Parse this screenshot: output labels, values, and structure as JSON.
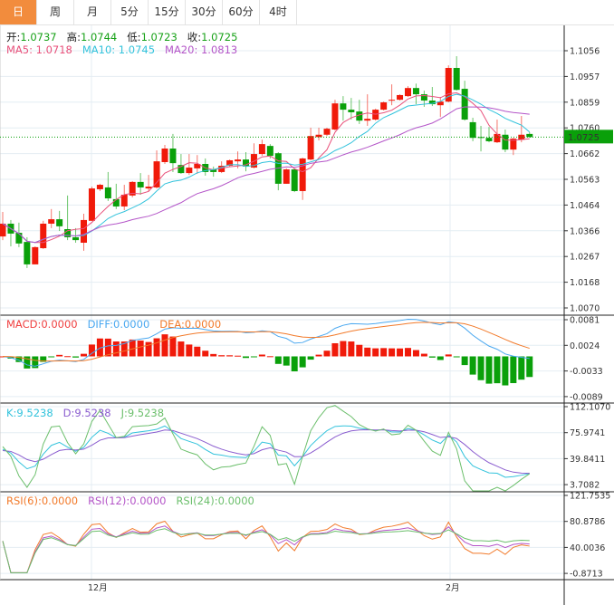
{
  "tabs": [
    {
      "label": "日",
      "active": true
    },
    {
      "label": "周"
    },
    {
      "label": "月"
    },
    {
      "label": "5分"
    },
    {
      "label": "15分"
    },
    {
      "label": "30分"
    },
    {
      "label": "60分"
    },
    {
      "label": "4时"
    }
  ],
  "ohlc_legend": {
    "open_label": "开:",
    "open": "1.0737",
    "high_label": "高:",
    "high": "1.0744",
    "low_label": "低:",
    "low": "1.0723",
    "close_label": "收:",
    "close": "1.0725"
  },
  "ma_legend": {
    "ma5": "MA5: 1.0718",
    "ma10": "MA10: 1.0745",
    "ma20": "MA20: 1.0813"
  },
  "macd_legend": {
    "macd": "MACD:0.0000",
    "diff": "DIFF:0.0000",
    "dea": "DEA:0.0000"
  },
  "kdj_legend": {
    "k": "K:9.5238",
    "d": "D:9.5238",
    "j": "J:9.5238"
  },
  "rsi_legend": {
    "rsi6": "RSI(6):0.0000",
    "rsi12": "RSI(12):0.0000",
    "rsi24": "RSI(24):0.0000"
  },
  "colors": {
    "up": "#f01a0a",
    "down": "#0aa00a",
    "ma5": "#e8507a",
    "ma10": "#33c3dc",
    "ma20": "#b455c8",
    "macd": "#f04040",
    "diff": "#4aa8f0",
    "dea": "#f27a2a",
    "k": "#33c3dc",
    "d": "#8a5ccf",
    "j": "#6cbf6c",
    "rsi6": "#f27a2a",
    "rsi12": "#b455c8",
    "rsi24": "#6cbf6c",
    "accent": "#f28c3d",
    "price_tag": "#0aa00a"
  },
  "price_axis": {
    "ticks": [
      "1.1056",
      "1.0957",
      "1.0859",
      "1.0760",
      "1.0662",
      "1.0563",
      "1.0464",
      "1.0366",
      "1.0267",
      "1.0168",
      "1.0070"
    ],
    "current": "1.0725"
  },
  "macd_axis": {
    "ticks": [
      "0.0081",
      "0.0024",
      "-0.0033",
      "-0.0089"
    ]
  },
  "kdj_axis": {
    "ticks": [
      "112.1070",
      "75.9741",
      "39.8411",
      "3.7082"
    ]
  },
  "rsi_axis": {
    "ticks": [
      "121.7535",
      "80.8786",
      "40.0036",
      "-0.8713"
    ]
  },
  "x_axis": {
    "labels": [
      "12月",
      "2月"
    ]
  },
  "chart_data": {
    "type": "candlestick",
    "columns": [
      "open",
      "high",
      "low",
      "close"
    ],
    "candles": [
      [
        1.0344,
        1.0438,
        1.033,
        1.0393
      ],
      [
        1.0393,
        1.0407,
        1.0306,
        1.0355
      ],
      [
        1.0358,
        1.0397,
        1.0303,
        1.0317
      ],
      [
        1.0323,
        1.0341,
        1.0223,
        1.0237
      ],
      [
        1.0237,
        1.0306,
        1.0237,
        1.0303
      ],
      [
        1.0299,
        1.0404,
        1.0296,
        1.0393
      ],
      [
        1.0393,
        1.0449,
        1.0376,
        1.041
      ],
      [
        1.041,
        1.0442,
        1.0365,
        1.0383
      ],
      [
        1.0372,
        1.0501,
        1.033,
        1.0341
      ],
      [
        1.0341,
        1.0376,
        1.032,
        1.033
      ],
      [
        1.032,
        1.0431,
        1.0289,
        1.0407
      ],
      [
        1.0404,
        1.0535,
        1.0404,
        1.0528
      ],
      [
        1.0525,
        1.0546,
        1.0518,
        1.0542
      ],
      [
        1.0532,
        1.0591,
        1.048,
        1.049
      ],
      [
        1.0487,
        1.0546,
        1.0449,
        1.0459
      ],
      [
        1.0459,
        1.0542,
        1.0445,
        1.0504
      ],
      [
        1.0501,
        1.0556,
        1.0494,
        1.0553
      ],
      [
        1.0553,
        1.0587,
        1.0504,
        1.0532
      ],
      [
        1.0528,
        1.058,
        1.0518,
        1.0535
      ],
      [
        1.0532,
        1.0674,
        1.0528,
        1.0632
      ],
      [
        1.0629,
        1.0695,
        1.0622,
        1.0681
      ],
      [
        1.0681,
        1.0737,
        1.0591,
        1.0625
      ],
      [
        1.0618,
        1.066,
        1.0584,
        1.0587
      ],
      [
        1.0587,
        1.066,
        1.058,
        1.0608
      ],
      [
        1.0605,
        1.0656,
        1.0584,
        1.0622
      ],
      [
        1.0622,
        1.0643,
        1.0577,
        1.0591
      ],
      [
        1.0601,
        1.0612,
        1.0573,
        1.0591
      ],
      [
        1.0591,
        1.0632,
        1.0587,
        1.0615
      ],
      [
        1.0615,
        1.0639,
        1.0612,
        1.0636
      ],
      [
        1.0632,
        1.067,
        1.0605,
        1.0639
      ],
      [
        1.0639,
        1.0667,
        1.0594,
        1.0612
      ],
      [
        1.0608,
        1.0701,
        1.0605,
        1.066
      ],
      [
        1.066,
        1.0715,
        1.0653,
        1.0698
      ],
      [
        1.0691,
        1.0698,
        1.0643,
        1.0653
      ],
      [
        1.0663,
        1.0667,
        1.0521,
        1.0546
      ],
      [
        1.0546,
        1.0605,
        1.0546,
        1.0601
      ],
      [
        1.0601,
        1.0605,
        1.0514,
        1.0518
      ],
      [
        1.0518,
        1.0646,
        1.0484,
        1.0643
      ],
      [
        1.0639,
        1.0761,
        1.0636,
        1.0729
      ],
      [
        1.0725,
        1.0761,
        1.0712,
        1.0734
      ],
      [
        1.0734,
        1.0761,
        1.0729,
        1.0757
      ],
      [
        1.0754,
        1.0868,
        1.075,
        1.0854
      ],
      [
        1.0854,
        1.0882,
        1.0788,
        1.083
      ],
      [
        1.083,
        1.0875,
        1.0792,
        1.082
      ],
      [
        1.0823,
        1.0868,
        1.0775,
        1.0788
      ],
      [
        1.0788,
        1.0889,
        1.0768,
        1.0795
      ],
      [
        1.0792,
        1.0834,
        1.0788,
        1.083
      ],
      [
        1.083,
        1.0861,
        1.0827,
        1.0858
      ],
      [
        1.0865,
        1.0927,
        1.0847,
        1.0868
      ],
      [
        1.0868,
        1.0889,
        1.0865,
        1.0886
      ],
      [
        1.0882,
        1.092,
        1.0879,
        1.0913
      ],
      [
        1.0913,
        1.093,
        1.0851,
        1.0889
      ],
      [
        1.0889,
        1.0903,
        1.0841,
        1.0865
      ],
      [
        1.0865,
        1.0917,
        1.0844,
        1.0851
      ],
      [
        1.0847,
        1.0879,
        1.0802,
        1.0861
      ],
      [
        1.0861,
        1.1,
        1.0858,
        1.099
      ],
      [
        1.099,
        1.1035,
        1.0903,
        1.0906
      ],
      [
        1.091,
        1.0941,
        1.0788,
        1.0792
      ],
      [
        1.0782,
        1.0799,
        1.0709,
        1.0722
      ],
      [
        1.0725,
        1.0768,
        1.067,
        1.0722
      ],
      [
        1.0722,
        1.0764,
        1.0705,
        1.0709
      ],
      [
        1.0705,
        1.0792,
        1.0702,
        1.0737
      ],
      [
        1.0734,
        1.0754,
        1.0667,
        1.0677
      ],
      [
        1.0677,
        1.0722,
        1.0656,
        1.0719
      ],
      [
        1.0715,
        1.0806,
        1.0705,
        1.0734
      ],
      [
        1.0737,
        1.0744,
        1.0723,
        1.0725
      ]
    ],
    "price_range": [
      1.007,
      1.1056
    ],
    "indicators": [
      "MA5",
      "MA10",
      "MA20",
      "MACD",
      "KDJ",
      "RSI"
    ],
    "grid": true
  }
}
